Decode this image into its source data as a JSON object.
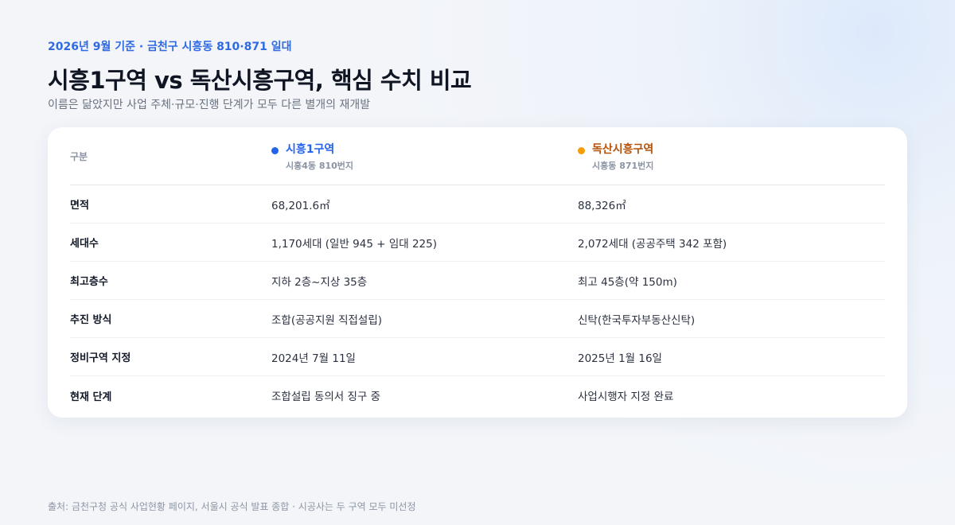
{
  "header": {
    "kicker": "2026년 9월 기준 · 금천구 시흥동 810·871 일대",
    "title": "시흥1구역 vs 독산시흥구역, 핵심 수치 비교",
    "subtitle": "이름은 닮았지만 사업 주체·규모·진행 단계가 모두 다른 별개의 재개발"
  },
  "table": {
    "category_label": "구분",
    "entities": [
      {
        "name": "시흥1구역",
        "sub": "시흥4동 810번지",
        "color": "#2563eb"
      },
      {
        "name": "독산시흥구역",
        "sub": "시흥동 871번지",
        "color": "#f59e0b",
        "name_color": "#b45309"
      }
    ],
    "rows": [
      {
        "label": "면적",
        "a": "68,201.6㎡",
        "b": "88,326㎡"
      },
      {
        "label": "세대수",
        "a": "1,170세대 (일반 945 + 임대 225)",
        "b": "2,072세대 (공공주택 342 포함)"
      },
      {
        "label": "최고층수",
        "a": "지하 2층~지상 35층",
        "b": "최고 45층(약 150m)"
      },
      {
        "label": "추진 방식",
        "a": "조합(공공지원 직접설립)",
        "b": "신탁(한국투자부동산신탁)"
      },
      {
        "label": "정비구역 지정",
        "a": "2024년 7월 11일",
        "b": "2025년 1월 16일"
      },
      {
        "label": "현재 단계",
        "a": "조합설립 동의서 징구 중",
        "b": "사업시행자 지정 완료"
      }
    ]
  },
  "footer": {
    "source": "출처: 금천구청 공식 사업현황 페이지, 서울시 공식 발표 종합 · 시공사는 두 구역 모두 미선정"
  }
}
